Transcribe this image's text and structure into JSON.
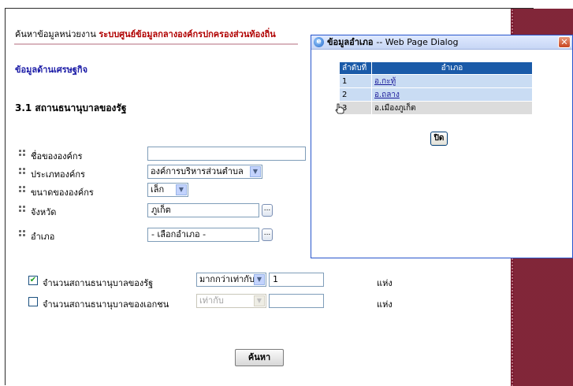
{
  "page": {
    "header_prefix": "ค้นหาข้อมูลหน่วยงาน",
    "header_system": "ระบบศูนย์ข้อมูลกลางองค์กรปกครองส่วนท้องถิ่น",
    "section_category": "ข้อมูลด้านเศรษฐกิจ",
    "section_title": "3.1 สถานธนานุบาลของรัฐ"
  },
  "form": {
    "org_name": {
      "label": "ชื่อขององค์กร",
      "value": ""
    },
    "org_type": {
      "label": "ประเภทองค์กร",
      "value": "องค์การบริหารส่วนตำบล"
    },
    "org_size": {
      "label": "ขนาดขององค์กร",
      "value": "เล็ก"
    },
    "province": {
      "label": "จังหวัด",
      "value": "ภูเก็ต"
    },
    "district": {
      "label": "อำเภอ",
      "value": "- เลือกอำเภอ -"
    }
  },
  "criteria": {
    "state": {
      "checked": true,
      "label": "จำนวนสถานธนานุบาลของรัฐ",
      "operator": "มากกว่าเท่ากับ",
      "value": "1",
      "unit": "แห่ง"
    },
    "private": {
      "checked": false,
      "label": "จำนวนสถานธนานุบาลของเอกชน",
      "operator": "เท่ากับ",
      "value": "",
      "unit": "แห่ง"
    }
  },
  "search_label": "ค้นหา",
  "dialog": {
    "title": "ข้อมูลอำเภอ",
    "title_suffix": "-- Web Page Dialog",
    "close_glyph": "✕",
    "columns": [
      "ลำดับที่",
      "อำเภอ"
    ],
    "rows": [
      {
        "no": "1",
        "name": "อ.กะทู้"
      },
      {
        "no": "2",
        "name": "อ.ถลาง"
      },
      {
        "no": "3",
        "name": "อ.เมืองภูเก็ต"
      }
    ],
    "close_button_label": "ปิด"
  },
  "colors": {
    "maroon_side": "#7a1a2e",
    "header_red": "#b00000",
    "section_blue": "#1a1aa6",
    "table_header": "#1a5aa8",
    "table_row": "#c9dcf3"
  },
  "icons": {
    "bullet": "dotted-bullet-icon",
    "browse": "ellipsis-button-icon",
    "dialog": "ie-icon",
    "cursor": "hand-cursor-icon"
  }
}
